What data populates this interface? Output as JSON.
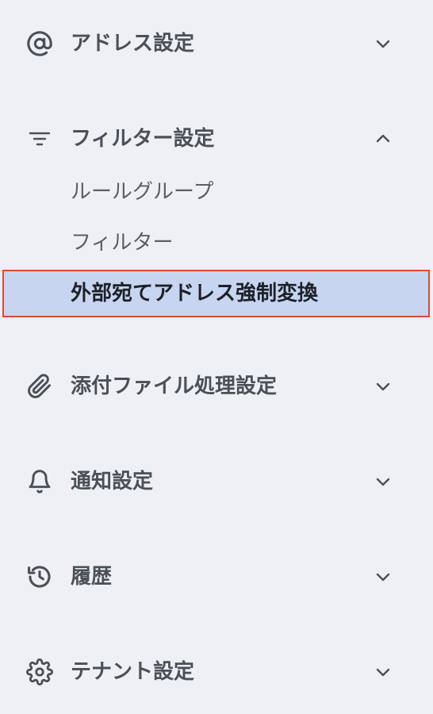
{
  "sidebar": {
    "sections": [
      {
        "label": "アドレス設定",
        "icon": "at-sign-icon",
        "expanded": false
      },
      {
        "label": "フィルター設定",
        "icon": "filter-lines-icon",
        "expanded": true,
        "items": [
          {
            "label": "ルールグループ",
            "active": false
          },
          {
            "label": "フィルター",
            "active": false
          },
          {
            "label": "外部宛てアドレス強制変換",
            "active": true
          }
        ]
      },
      {
        "label": "添付ファイル処理設定",
        "icon": "paperclip-icon",
        "expanded": false
      },
      {
        "label": "通知設定",
        "icon": "bell-icon",
        "expanded": false
      },
      {
        "label": "履歴",
        "icon": "history-icon",
        "expanded": false
      },
      {
        "label": "テナント設定",
        "icon": "gear-icon",
        "expanded": false
      }
    ]
  },
  "colors": {
    "background": "#eef0f4",
    "active_bg": "#c7d5f1",
    "active_border": "#e04a35",
    "text": "#4b5058",
    "active_text": "#1d2127"
  }
}
